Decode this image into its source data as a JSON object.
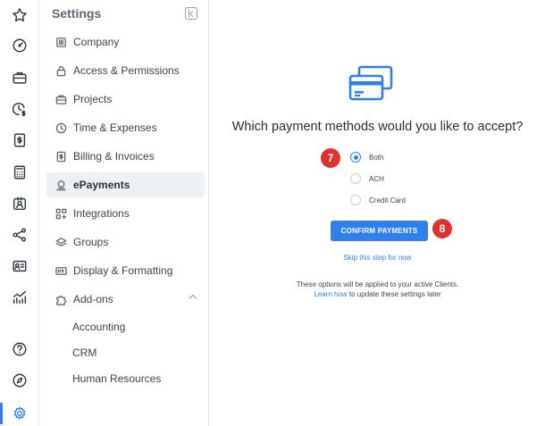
{
  "rail": {
    "icons": [
      "star-icon",
      "dashboard-icon",
      "briefcase-icon",
      "clock-dollar-icon",
      "invoice-icon",
      "calculator-icon",
      "contact-icon",
      "share-icon",
      "id-card-icon",
      "analytics-icon",
      "help-icon",
      "compass-icon",
      "settings-icon"
    ],
    "active_icon": "settings-icon"
  },
  "panel": {
    "title": "Settings",
    "items": [
      {
        "label": "Company",
        "icon": "building-icon"
      },
      {
        "label": "Access & Permissions",
        "icon": "lock-icon"
      },
      {
        "label": "Projects",
        "icon": "projects-icon"
      },
      {
        "label": "Time & Expenses",
        "icon": "clock-icon"
      },
      {
        "label": "Billing & Invoices",
        "icon": "billing-icon"
      },
      {
        "label": "ePayments",
        "icon": "epayments-icon",
        "active": true
      },
      {
        "label": "Integrations",
        "icon": "integrations-icon"
      },
      {
        "label": "Groups",
        "icon": "layers-icon"
      },
      {
        "label": "Display & Formatting",
        "icon": "display-icon"
      },
      {
        "label": "Add-ons",
        "icon": "puzzle-icon",
        "expanded": true
      }
    ],
    "addons": [
      "Accounting",
      "CRM",
      "Human Resources"
    ]
  },
  "main": {
    "heading": "Which payment methods would you like to accept?",
    "options": [
      {
        "label": "Both",
        "checked": true
      },
      {
        "label": "ACH",
        "checked": false
      },
      {
        "label": "Credit Card",
        "checked": false
      }
    ],
    "confirm_label": "CONFIRM PAYMENTS",
    "skip_label": "Skip this step for now",
    "note_line1": "These options will be applied to your active Clients.",
    "learn_how": "Learn how",
    "note_line2_rest": " to update these settings later",
    "badges": [
      "7",
      "8"
    ]
  },
  "colors": {
    "accent": "#2f80ed",
    "badge": "#e0312e",
    "active_bg": "#eef1f4"
  }
}
